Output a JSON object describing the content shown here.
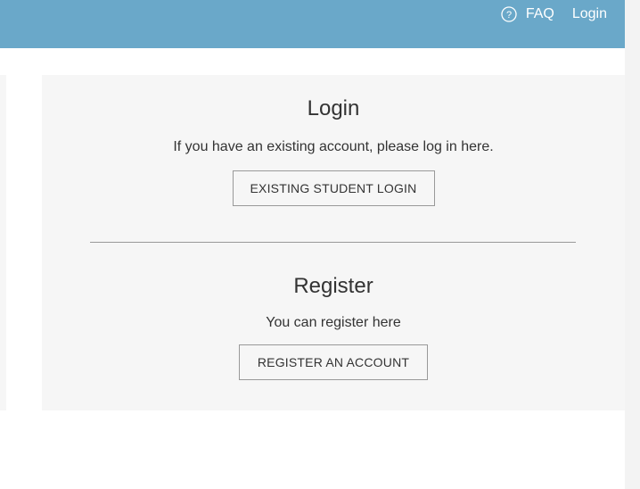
{
  "header": {
    "help_icon": "question-circle-icon",
    "faq_label": "FAQ",
    "login_label": "Login",
    "bar_color": "#6aa8c9"
  },
  "login": {
    "title": "Login",
    "text": "If you have an existing account, please log in here.",
    "button_label": "EXISTING STUDENT LOGIN"
  },
  "register": {
    "title": "Register",
    "text": "You can register here",
    "button_label": "REGISTER AN ACCOUNT"
  }
}
